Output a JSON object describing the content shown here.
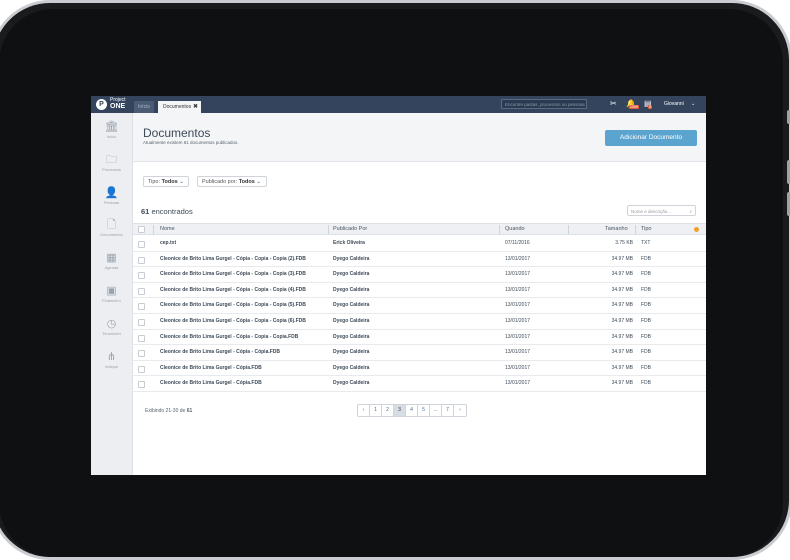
{
  "topbar": {
    "logo_small": "Project",
    "logo_big": "ONE",
    "tab_home": "Início",
    "tab_active": "Documentos",
    "search_placeholder": "Encontre pastas, processos ou pessoas",
    "badge_notifications": "1099",
    "badge_messages": "8",
    "user_name": "Giovanni"
  },
  "sidebar": {
    "items": [
      {
        "label": "Início",
        "icon": "bank-icon"
      },
      {
        "label": "Processos",
        "icon": "folder-icon"
      },
      {
        "label": "Pessoas",
        "icon": "person-icon"
      },
      {
        "label": "Documentos",
        "icon": "document-icon"
      },
      {
        "label": "Agenda",
        "icon": "calendar-icon"
      },
      {
        "label": "Financeiro",
        "icon": "money-icon"
      },
      {
        "label": "Timesheet",
        "icon": "clock-icon"
      },
      {
        "label": "Indique",
        "icon": "share-icon"
      }
    ]
  },
  "header": {
    "title": "Documentos",
    "subtitle": "Atualmente existem 61 documentos publicados.",
    "add_button": "Adicionar Documento"
  },
  "filters": {
    "tipo_label": "Tipo:",
    "tipo_value": "Todos",
    "publicado_label": "Publicado por:",
    "publicado_value": "Todos"
  },
  "results": {
    "count": "61",
    "count_label": "encontrados",
    "description_placeholder": "Nome e descrição..."
  },
  "table": {
    "columns": [
      "Nome",
      "Publicado Por",
      "Quando",
      "Tamanho",
      "Tipo"
    ],
    "rows": [
      {
        "name": "cep.txt",
        "by": "Erick Oliveira",
        "when": "07/11/2016",
        "size": "3.75 KB",
        "type": "TXT"
      },
      {
        "name": "Cleonice de Brito Lima Gurgel - Cópia - Copia - Copia (2).FDB",
        "by": "Dyego Caldeira",
        "when": "13/01/2017",
        "size": "34.97 MB",
        "type": "FDB"
      },
      {
        "name": "Cleonice de Brito Lima Gurgel - Cópia - Copia - Copia (3).FDB",
        "by": "Dyego Caldeira",
        "when": "13/01/2017",
        "size": "34.97 MB",
        "type": "FDB"
      },
      {
        "name": "Cleonice de Brito Lima Gurgel - Cópia - Copia - Copia (4).FDB",
        "by": "Dyego Caldeira",
        "when": "13/01/2017",
        "size": "34.97 MB",
        "type": "FDB"
      },
      {
        "name": "Cleonice de Brito Lima Gurgel - Cópia - Copia - Copia (5).FDB",
        "by": "Dyego Caldeira",
        "when": "13/01/2017",
        "size": "34.97 MB",
        "type": "FDB"
      },
      {
        "name": "Cleonice de Brito Lima Gurgel - Cópia - Copia - Copia (6).FDB",
        "by": "Dyego Caldeira",
        "when": "13/01/2017",
        "size": "34.97 MB",
        "type": "FDB"
      },
      {
        "name": "Cleonice de Brito Lima Gurgel - Cópia - Copia - Copia.FDB",
        "by": "Dyego Caldeira",
        "when": "13/01/2017",
        "size": "34.97 MB",
        "type": "FDB"
      },
      {
        "name": "Cleonice de Brito Lima Gurgel - Cópia - Cópia.FDB",
        "by": "Dyego Caldeira",
        "when": "13/01/2017",
        "size": "34.97 MB",
        "type": "FDB"
      },
      {
        "name": "Cleonice de Brito Lima Gurgel - Cópia.FDB",
        "by": "Dyego Caldeira",
        "when": "13/01/2017",
        "size": "34.97 MB",
        "type": "FDB"
      },
      {
        "name": "Cleonice de Brito Lima Gurgel - Cópia.FDB",
        "by": "Dyego Caldeira",
        "when": "13/01/2017",
        "size": "34.97 MB",
        "type": "FDB"
      }
    ]
  },
  "pagination": {
    "summary_prefix": "Exibindo 21-30 de",
    "total": "61",
    "pages": [
      "‹",
      "1",
      "2",
      "3",
      "4",
      "5",
      "...",
      "7",
      "›"
    ],
    "active_page": "3"
  }
}
